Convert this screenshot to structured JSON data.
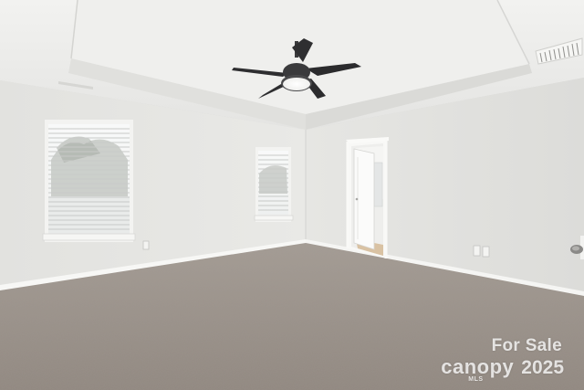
{
  "watermark": {
    "line1": "For Sale",
    "brand": "canopy",
    "brand_sub": "MLS",
    "year": "2025"
  },
  "colors": {
    "wall_left": "#e7e7e4",
    "wall_right": "#e3e3e0",
    "ceiling": "#ededeb",
    "carpet": "#9d948c",
    "fan_dark": "#2b2b2d",
    "trim": "#f7f7f5"
  }
}
